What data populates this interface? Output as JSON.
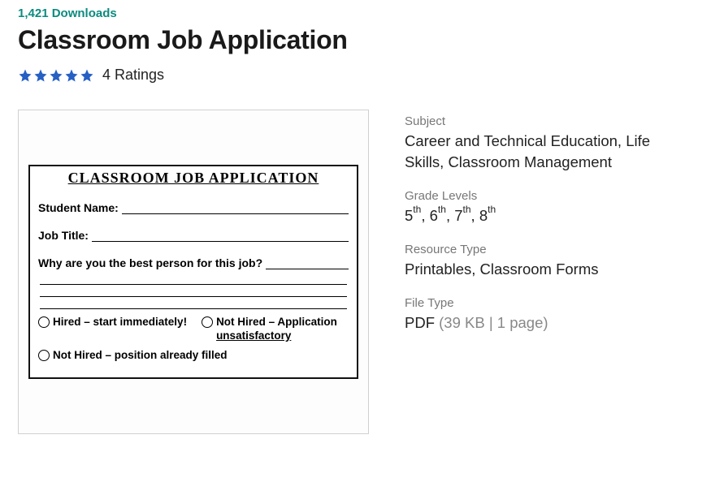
{
  "downloads_text": "1,421 Downloads",
  "title": "Classroom Job Application",
  "rating": {
    "stars": 5,
    "label": "4 Ratings"
  },
  "preview": {
    "heading": "CLASSROOM JOB APPLICATION",
    "student_name_label": "Student Name:",
    "job_title_label": "Job Title:",
    "why_label": "Why are you the best person for this job?",
    "options": {
      "hired": "Hired – start immediately!",
      "not_hired_app_prefix": "Not Hired – Application",
      "not_hired_app_under": "unsatisfactory",
      "not_hired_filled": "Not Hired – position already filled"
    }
  },
  "meta": {
    "subject_label": "Subject",
    "subject_value": "Career and Technical Education, Life Skills, Classroom Management",
    "grade_label": "Grade Levels",
    "grades": [
      "5",
      "6",
      "7",
      "8"
    ],
    "grade_suffix": "th",
    "resource_label": "Resource Type",
    "resource_value": "Printables, Classroom Forms",
    "filetype_label": "File Type",
    "filetype_value": "PDF",
    "filetype_detail": "(39 KB | 1 page)"
  }
}
